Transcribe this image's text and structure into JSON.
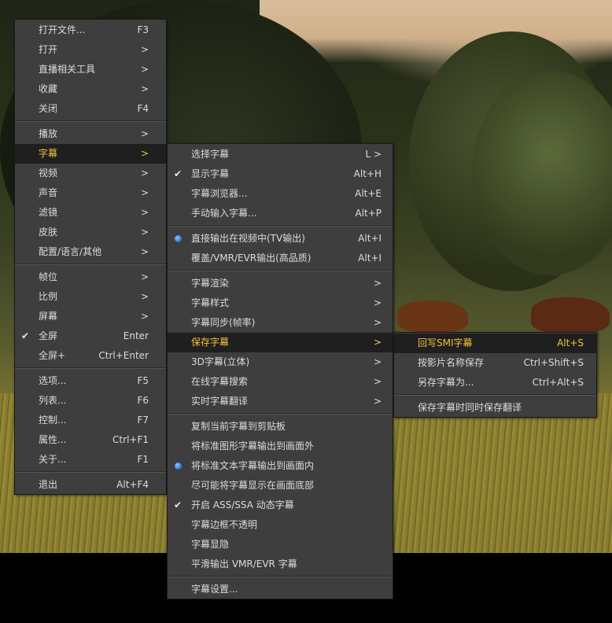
{
  "main_menu": [
    {
      "label": "打开文件...",
      "shortcut": "F3"
    },
    {
      "label": "打开",
      "shortcut": ">"
    },
    {
      "label": "直播相关工具",
      "shortcut": ">"
    },
    {
      "label": "收藏",
      "shortcut": ">"
    },
    {
      "label": "关闭",
      "shortcut": "F4"
    },
    {
      "label": "播放",
      "shortcut": ">"
    },
    {
      "label": "字幕",
      "shortcut": ">"
    },
    {
      "label": "视频",
      "shortcut": ">"
    },
    {
      "label": "声音",
      "shortcut": ">"
    },
    {
      "label": "滤镜",
      "shortcut": ">"
    },
    {
      "label": "皮肤",
      "shortcut": ">"
    },
    {
      "label": "配置/语言/其他",
      "shortcut": ">"
    },
    {
      "label": "帧位",
      "shortcut": ">"
    },
    {
      "label": "比例",
      "shortcut": ">"
    },
    {
      "label": "屏幕",
      "shortcut": ">"
    },
    {
      "label": "全屏",
      "shortcut": "Enter"
    },
    {
      "label": "全屏+",
      "shortcut": "Ctrl+Enter"
    },
    {
      "label": "选项...",
      "shortcut": "F5"
    },
    {
      "label": "列表...",
      "shortcut": "F6"
    },
    {
      "label": "控制...",
      "shortcut": "F7"
    },
    {
      "label": "属性...",
      "shortcut": "Ctrl+F1"
    },
    {
      "label": "关于...",
      "shortcut": "F1"
    },
    {
      "label": "退出",
      "shortcut": "Alt+F4"
    }
  ],
  "subtitle_menu": [
    {
      "label": "选择字幕",
      "shortcut": "L >"
    },
    {
      "label": "显示字幕",
      "shortcut": "Alt+H"
    },
    {
      "label": "字幕浏览器...",
      "shortcut": "Alt+E"
    },
    {
      "label": "手动输入字幕...",
      "shortcut": "Alt+P"
    },
    {
      "label": "直接输出在视频中(TV输出)",
      "shortcut": "Alt+I"
    },
    {
      "label": "覆盖/VMR/EVR输出(高品质)",
      "shortcut": "Alt+I"
    },
    {
      "label": "字幕渲染",
      "shortcut": ">"
    },
    {
      "label": "字幕样式",
      "shortcut": ">"
    },
    {
      "label": "字幕同步(帧率)",
      "shortcut": ">"
    },
    {
      "label": "保存字幕",
      "shortcut": ">"
    },
    {
      "label": "3D字幕(立体)",
      "shortcut": ">"
    },
    {
      "label": "在线字幕搜索",
      "shortcut": ">"
    },
    {
      "label": "实时字幕翻译",
      "shortcut": ">"
    },
    {
      "label": "复制当前字幕到剪贴板",
      "shortcut": ""
    },
    {
      "label": "将标准图形字幕输出到画面外",
      "shortcut": ""
    },
    {
      "label": "将标准文本字幕输出到画面内",
      "shortcut": ""
    },
    {
      "label": "尽可能将字幕显示在画面底部",
      "shortcut": ""
    },
    {
      "label": "开启 ASS/SSA 动态字幕",
      "shortcut": ""
    },
    {
      "label": "字幕边框不透明",
      "shortcut": ""
    },
    {
      "label": "字幕显隐",
      "shortcut": ""
    },
    {
      "label": "平滑输出 VMR/EVR 字幕",
      "shortcut": ""
    },
    {
      "label": "字幕设置...",
      "shortcut": ""
    }
  ],
  "save_menu": [
    {
      "label": "回写SMI字幕",
      "shortcut": "Alt+S"
    },
    {
      "label": "按影片名称保存",
      "shortcut": "Ctrl+Shift+S"
    },
    {
      "label": "另存字幕为...",
      "shortcut": "Ctrl+Alt+S"
    },
    {
      "label": "保存字幕时同时保存翻译",
      "shortcut": ""
    }
  ],
  "colors": {
    "menu_bg": "#3e3e3e",
    "selected_bg": "#1f1f1f",
    "highlight_text": "#f2c23a",
    "text": "#dcdcdc",
    "radio": "#2f7fe0"
  }
}
